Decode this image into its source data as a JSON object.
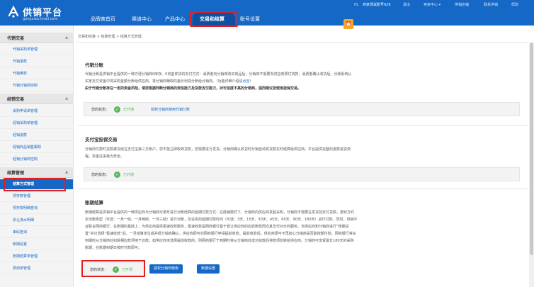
{
  "header": {
    "logo_text": "供销平台",
    "logo_domain": "gongxiao.tmall.com",
    "nav": [
      "品牌商首页",
      "渠道中心",
      "产品中心",
      "交易和结算",
      "账号设置"
    ],
    "active_nav": "交易和结算",
    "util": {
      "greeting": "Hi,",
      "account": "商家测试账号029",
      "logout": "退出",
      "seller_center": "卖家中心 ▾",
      "distributor_shop": "供销店铺",
      "contact": "联系供销",
      "help": "帮助"
    },
    "bell_icon": "bell-icon"
  },
  "sidebar": {
    "sections": [
      {
        "title": "代销交易",
        "items": [
          "代销采购单管理",
          "代销退款",
          "代销维权",
          "代销分销商控制"
        ]
      },
      {
        "title": "经销交易",
        "items": [
          "采购申请单管理",
          "经销采购单管理",
          "经销退款",
          "经销商品销售跟踪",
          "经销分销商控制"
        ]
      },
      {
        "title": "结算管理",
        "items": [
          "结算方式管理",
          "预存款管理",
          "预存款明细查询",
          "折让流水明细",
          "串码查询",
          "账期设置",
          "账期结算单管理",
          "费用单管理"
        ]
      }
    ],
    "active_item": "结算方式管理"
  },
  "breadcrumb": "交易和结算 > 结算管理 > 结算方式管理",
  "sections": {
    "dai": {
      "title": "代销分账",
      "desc1": "代销分账是供销平台提供的一种方便分销商0库存、0资金拿货的支付方式：消费者向分销商购买商品后，分销商不需要向供应商预付货款，消费者确认收货后，分账系统从",
      "desc2": "买家支付资金中将采购金额分账给供应商，将分销商赚取的差价利润分账给分销商。（功能详细介绍",
      "desc2_link": "请点击",
      "desc2_end": "）",
      "desc3": "由于代销分账存在一定的资金风险，请您根据判断分销商的资信能力及货款支付能力，对可信度不高的分销商，强烈建议您使用担保交易。",
      "status_label": "您的状态：",
      "status_value": "已开通",
      "action_link": "授权分销商使用代销分账"
    },
    "alipay": {
      "title": "支付宝担保交易",
      "desc1": "分销商付款时货款被冻结在支付宝第三方账户，您不能立即收到货款，您需要进行发货，分销商确认收货时分销自动将货款实时结算给供应商。平台提供完整的退款退货流",
      "desc2": "程，资金往来最为安全。",
      "status_label": "您的状态：",
      "status_value": "已开通"
    },
    "period": {
      "title": "账期结算",
      "desc1": "账期结算是供销平台提供的一种供应商与分销商可按月进行对账结算的延期付款方式：在经销模式下，分销商向供应商发起采购，分销商不需要在发货前支付货款，按双方约",
      "desc2": "定出账类型（可选：一月一结、一月两结、一月三结）进行对账，及设定的延期付款时间（可选：3天、15天、30天、45天、60天、90天、180天）进行付款。同时，供销平",
      "desc3": "台联合网商银行，在账期的基础上，为供应商提供极速收款服务，极速收款是网商银行基于受让供应商的应收账款而向其支付对价的服务。当供应商和分销商进行“账期设",
      "desc4": "置”并只选择“极速收款”后，一旦结算单生成并经分销商确认，供应商即可向网商银行申请提前收款，提前收款后，供应商便可不再担心分销商是否能按期付款，网商银行将在",
      "desc5": "到期时从分销商处扣除相应款项用于还款；如供应商未选择提前收款的，则网商银行于到期时将从分销商处成功扣款后将款项划转给供应商。分销商可享受最长180天的采购",
      "desc6": "账期，在账期到期日按时付款即可。",
      "status_label": "您的状态：",
      "status_value": "已开通",
      "btn_authorize": "授权分销商使用",
      "btn_settings": "账期设置"
    }
  },
  "colors": {
    "brand": "#1568c6",
    "success": "#5cb85c",
    "highlight": "#e02020",
    "bell": "#f5a623"
  }
}
